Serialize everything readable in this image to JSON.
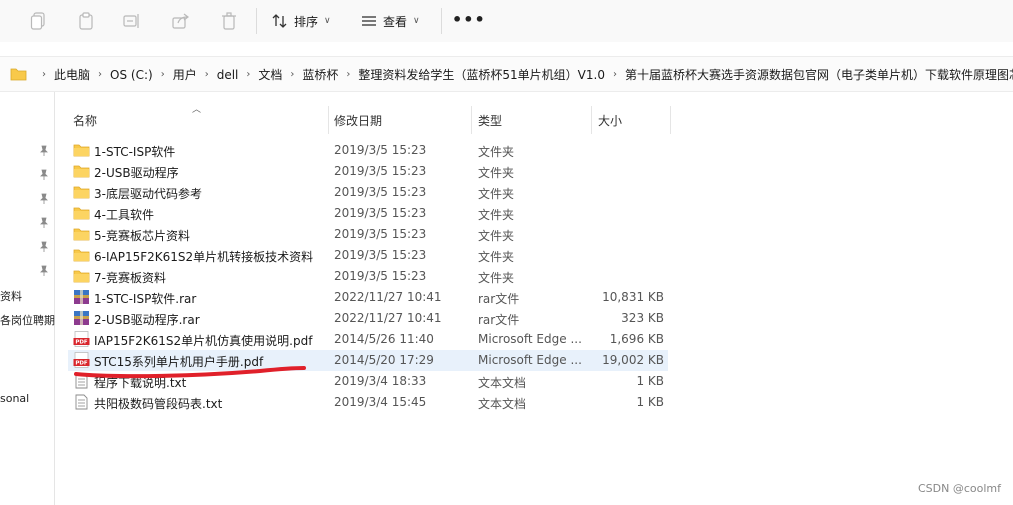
{
  "toolbar": {
    "sort_label": "排序",
    "view_label": "查看",
    "more_label": "•••"
  },
  "address": {
    "crumbs": [
      "此电脑",
      "OS (C:)",
      "用户",
      "dell",
      "文档",
      "蓝桥杯",
      "整理资料发给学生（蓝桥杯51单片机组）V1.0",
      "第十届蓝桥杯大赛选手资源数据包官网（电子类单片机）下载软件原理图芯"
    ]
  },
  "nav": {
    "partial_items": [
      "资料",
      "各岗位聘期",
      "sonal"
    ]
  },
  "columns": {
    "name": "名称",
    "date": "修改日期",
    "type": "类型",
    "size": "大小"
  },
  "files": [
    {
      "name": "1-STC-ISP软件",
      "date": "2019/3/5 15:23",
      "type": "文件夹",
      "size": "",
      "icon": "folder-icon"
    },
    {
      "name": "2-USB驱动程序",
      "date": "2019/3/5 15:23",
      "type": "文件夹",
      "size": "",
      "icon": "folder-icon"
    },
    {
      "name": "3-底层驱动代码参考",
      "date": "2019/3/5 15:23",
      "type": "文件夹",
      "size": "",
      "icon": "folder-icon"
    },
    {
      "name": "4-工具软件",
      "date": "2019/3/5 15:23",
      "type": "文件夹",
      "size": "",
      "icon": "folder-icon"
    },
    {
      "name": "5-竞赛板芯片资料",
      "date": "2019/3/5 15:23",
      "type": "文件夹",
      "size": "",
      "icon": "folder-icon"
    },
    {
      "name": "6-IAP15F2K61S2单片机转接板技术资料",
      "date": "2019/3/5 15:23",
      "type": "文件夹",
      "size": "",
      "icon": "folder-icon"
    },
    {
      "name": "7-竞赛板资料",
      "date": "2019/3/5 15:23",
      "type": "文件夹",
      "size": "",
      "icon": "folder-icon"
    },
    {
      "name": "1-STC-ISP软件.rar",
      "date": "2022/11/27 10:41",
      "type": "rar文件",
      "size": "10,831 KB",
      "icon": "rar-icon"
    },
    {
      "name": "2-USB驱动程序.rar",
      "date": "2022/11/27 10:41",
      "type": "rar文件",
      "size": "323 KB",
      "icon": "rar-icon"
    },
    {
      "name": "IAP15F2K61S2单片机仿真使用说明.pdf",
      "date": "2014/5/26 11:40",
      "type": "Microsoft Edge ...",
      "size": "1,696 KB",
      "icon": "pdf-icon"
    },
    {
      "name": "STC15系列单片机用户手册.pdf",
      "date": "2014/5/20 17:29",
      "type": "Microsoft Edge ...",
      "size": "19,002 KB",
      "icon": "pdf-icon",
      "selected": true
    },
    {
      "name": "程序下载说明.txt",
      "date": "2019/3/4 18:33",
      "type": "文本文档",
      "size": "1 KB",
      "icon": "txt-icon"
    },
    {
      "name": "共阳极数码管段码表.txt",
      "date": "2019/3/4 15:45",
      "type": "文本文档",
      "size": "1 KB",
      "icon": "txt-icon"
    }
  ],
  "watermark": "CSDN @coolmf",
  "colors": {
    "folder": "#f8c94a",
    "pdf": "#d9262c",
    "selection": "#e8f1fb",
    "annotation": "#e0202a"
  }
}
